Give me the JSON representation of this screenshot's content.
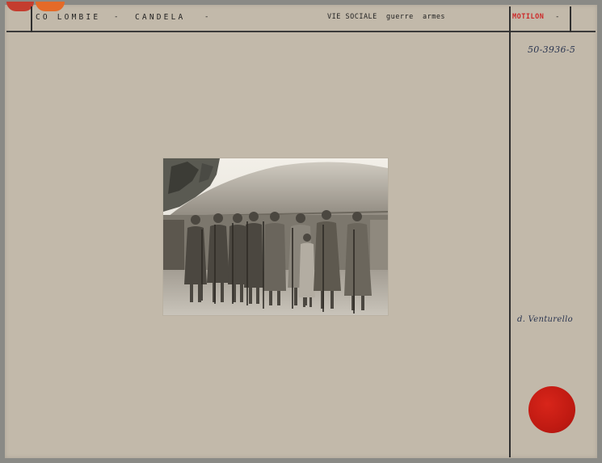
{
  "header": {
    "country": "CO LOMBIE",
    "place": "CANDELA",
    "subject": "VIE SOCIALE  guerre  armes",
    "tribe": "MOTILON",
    "dash": "-"
  },
  "inventory_number": "50-3936-5",
  "credit": "d. Venturello",
  "photo": {
    "description_icon": "photograph-icon"
  },
  "colors": {
    "card": "#c2b9aa",
    "seal": "#c01a12",
    "tab_red": "#c43d2f",
    "tab_orange": "#e46a28",
    "tribe_text": "#cc2a2a"
  }
}
